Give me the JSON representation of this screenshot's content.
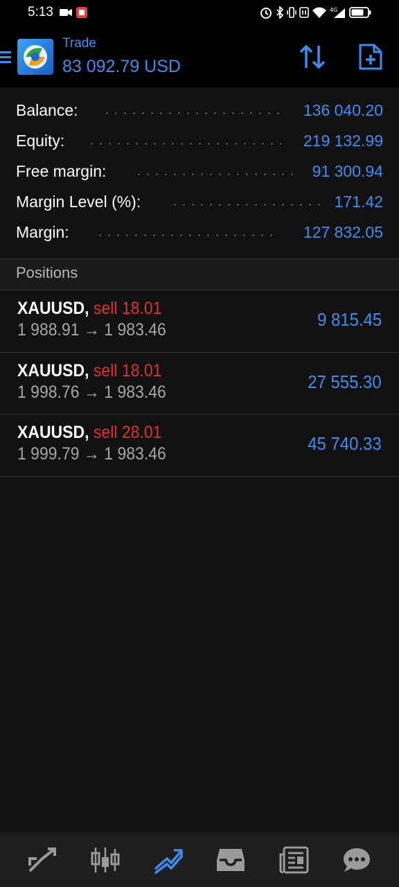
{
  "status_bar": {
    "time": "5:13"
  },
  "header": {
    "title": "Trade",
    "subtitle": "83 092.79 USD"
  },
  "summary": [
    {
      "label": "Balance:",
      "value": "136 040.20"
    },
    {
      "label": "Equity:",
      "value": "219 132.99"
    },
    {
      "label": "Free margin:",
      "value": "91 300.94"
    },
    {
      "label": "Margin Level (%):",
      "value": "171.42"
    },
    {
      "label": "Margin:",
      "value": "127 832.05"
    }
  ],
  "positions_title": "Positions",
  "positions": [
    {
      "symbol": "XAUUSD,",
      "side": "sell 18.01",
      "prices": "1 988.91 → 1 983.46",
      "profit": "9 815.45"
    },
    {
      "symbol": "XAUUSD,",
      "side": "sell 18.01",
      "prices": "1 998.76 → 1 983.46",
      "profit": "27 555.30"
    },
    {
      "symbol": "XAUUSD,",
      "side": "sell 28.01",
      "prices": "1 999.79 → 1 983.46",
      "profit": "45 740.33"
    }
  ],
  "nav": [
    {
      "icon": "quotes-icon"
    },
    {
      "icon": "chart-icon"
    },
    {
      "icon": "trade-icon",
      "active": true
    },
    {
      "icon": "history-icon"
    },
    {
      "icon": "news-icon"
    },
    {
      "icon": "chat-icon"
    }
  ],
  "colors": {
    "accent": "#3d8ef0",
    "sell": "#e03030",
    "background": "#111111"
  }
}
